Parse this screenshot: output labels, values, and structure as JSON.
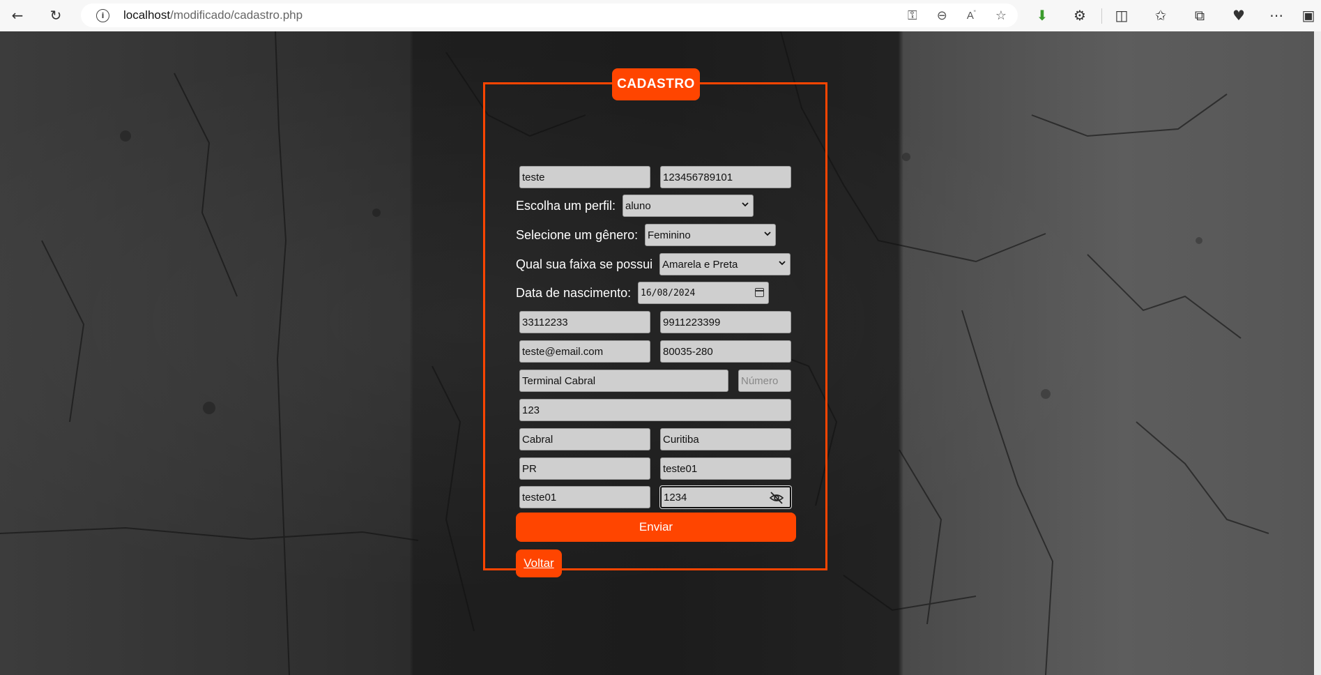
{
  "browser": {
    "url_host": "localhost",
    "url_path": "/modificado/cadastro.php"
  },
  "form": {
    "legend": "CADASTRO",
    "nome": "teste",
    "cpf": "123456789101",
    "perfil_label": "Escolha um perfil:",
    "perfil_value": "aluno",
    "genero_label": "Selecione um gênero:",
    "genero_value": "Feminino",
    "faixa_label": "Qual sua faixa se possui",
    "faixa_value": "Amarela e Preta",
    "nascimento_label": "Data de nascimento:",
    "nascimento_value": "16/08/2024",
    "telefone": "33112233",
    "celular": "9911223399",
    "email": "teste@email.com",
    "cep": "80035-280",
    "rua": "Terminal Cabral",
    "numero_placeholder": "Número",
    "complemento": "123",
    "bairro": "Cabral",
    "cidade": "Curitiba",
    "estado": "PR",
    "usuario": "teste01",
    "login": "teste01",
    "senha": "1234",
    "enviar": "Enviar",
    "voltar": "Voltar"
  },
  "colors": {
    "accent": "#ff4500",
    "field_bg": "#cfcfcf"
  }
}
